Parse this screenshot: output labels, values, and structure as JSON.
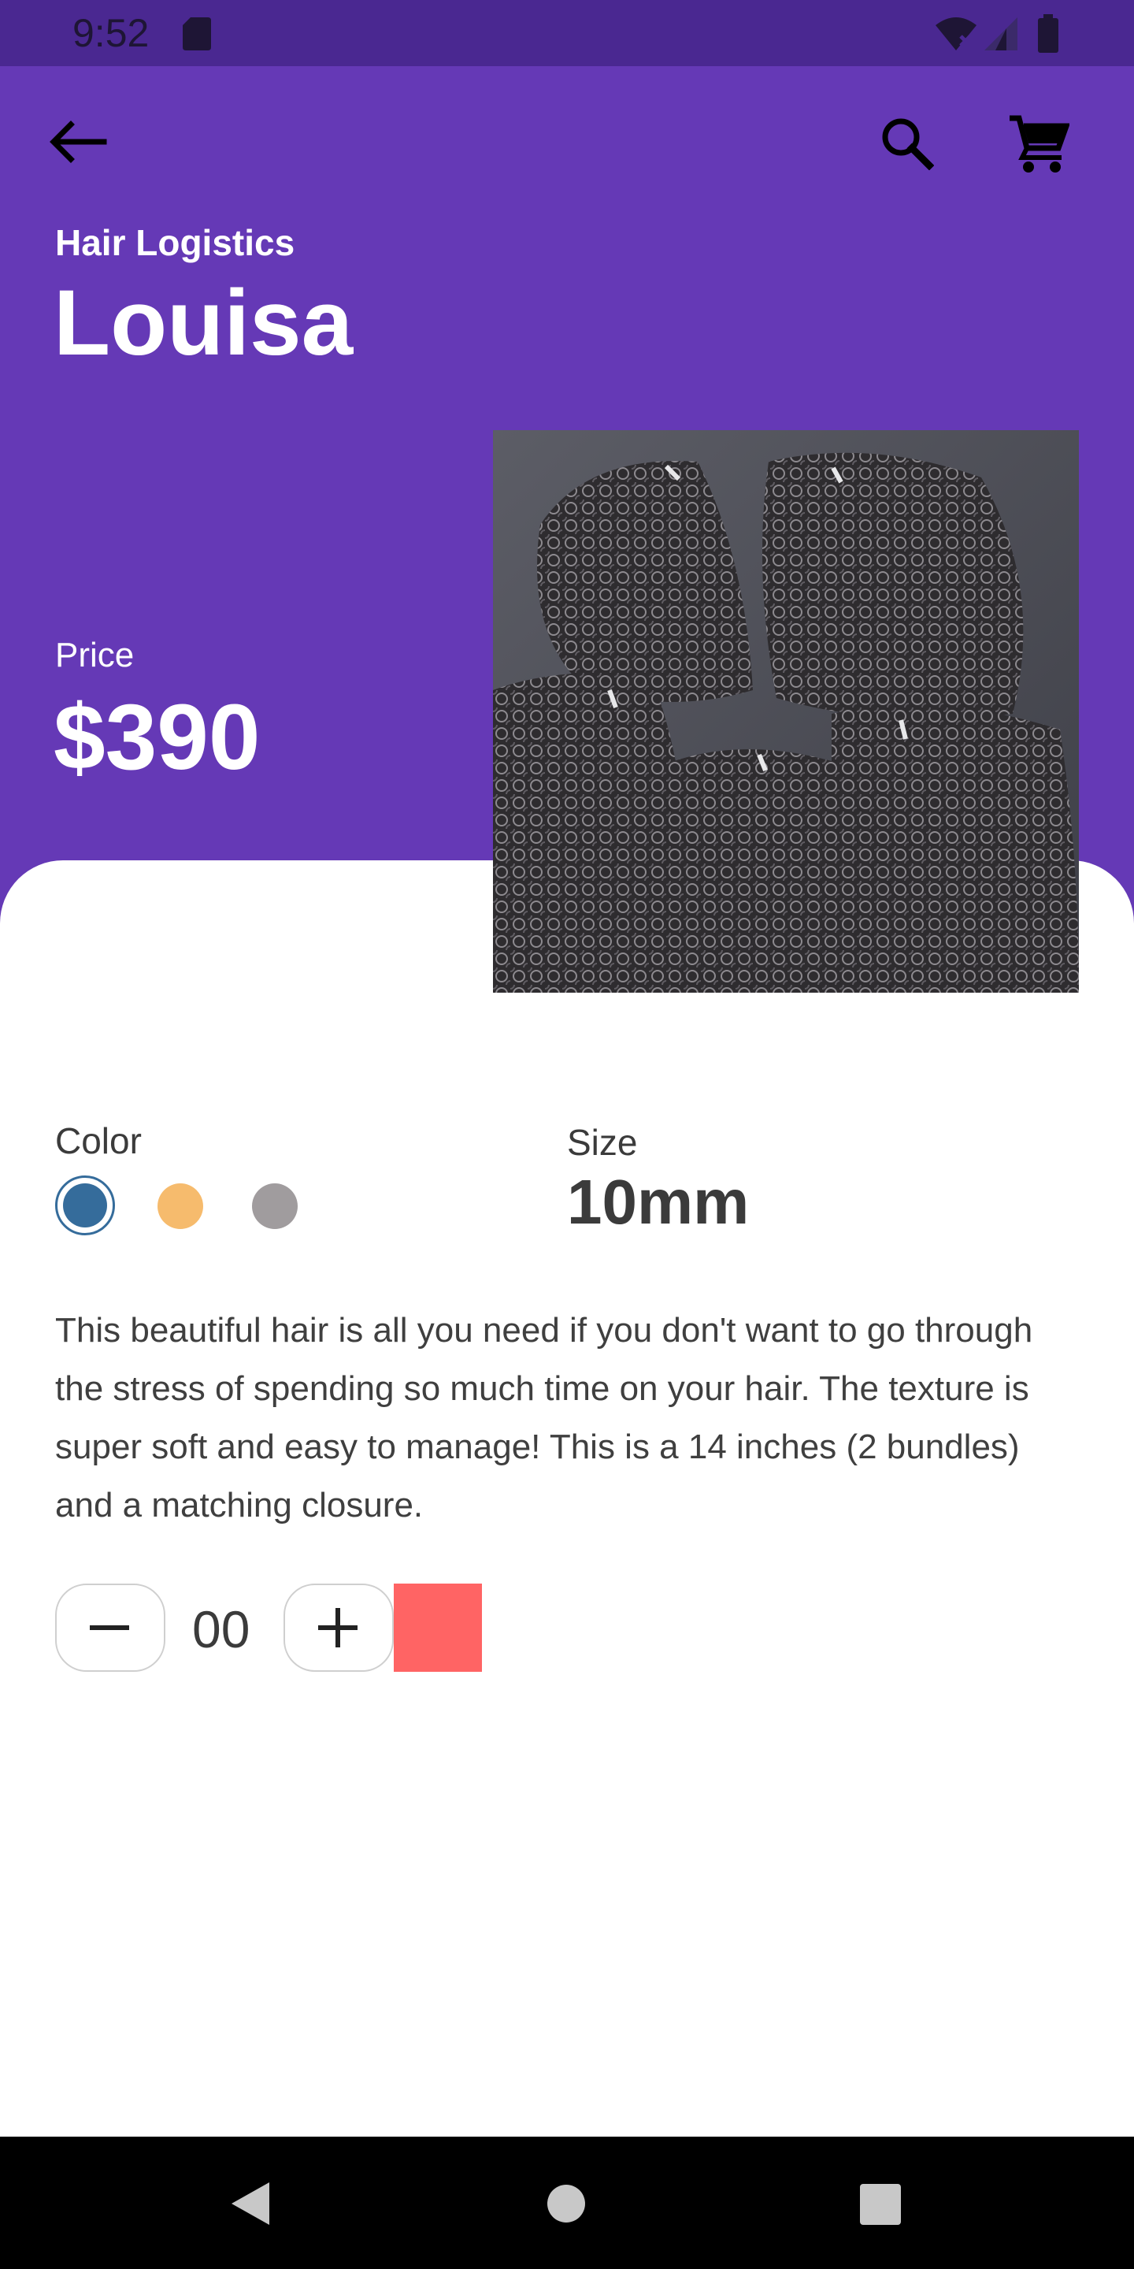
{
  "status_bar": {
    "time": "9:52",
    "icons": [
      "sd-card-icon",
      "wifi-icon",
      "signal-icon",
      "battery-icon"
    ]
  },
  "app_bar": {
    "back_icon": "arrow-left-icon",
    "search_icon": "search-icon",
    "cart_icon": "shopping-cart-icon"
  },
  "product": {
    "brand": "Hair Logistics",
    "title": "Louisa",
    "price_label": "Price",
    "price": "$390",
    "image_description": "curly hair bundles",
    "color_label": "Color",
    "colors": [
      "#356c9b",
      "#f6bb6d",
      "#a09c9e"
    ],
    "selected_color_index": 0,
    "size_label": "Size",
    "size": "10mm",
    "description": "This beautiful hair is all you need if you don't want to go through the stress of spending so much time on your hair. The texture is super soft and easy to manage! This is a 14 inches (2 bundles) and a matching closure."
  },
  "quantity": {
    "decrement_icon": "minus-icon",
    "value": "00",
    "increment_icon": "plus-icon"
  },
  "nav_bar": {
    "back": "nav-back-icon",
    "home": "nav-home-icon",
    "recents": "nav-recents-icon"
  },
  "theme": {
    "primary": "#6539b6",
    "status_bar": "#4a2891",
    "accent_button": "#ff6464"
  }
}
